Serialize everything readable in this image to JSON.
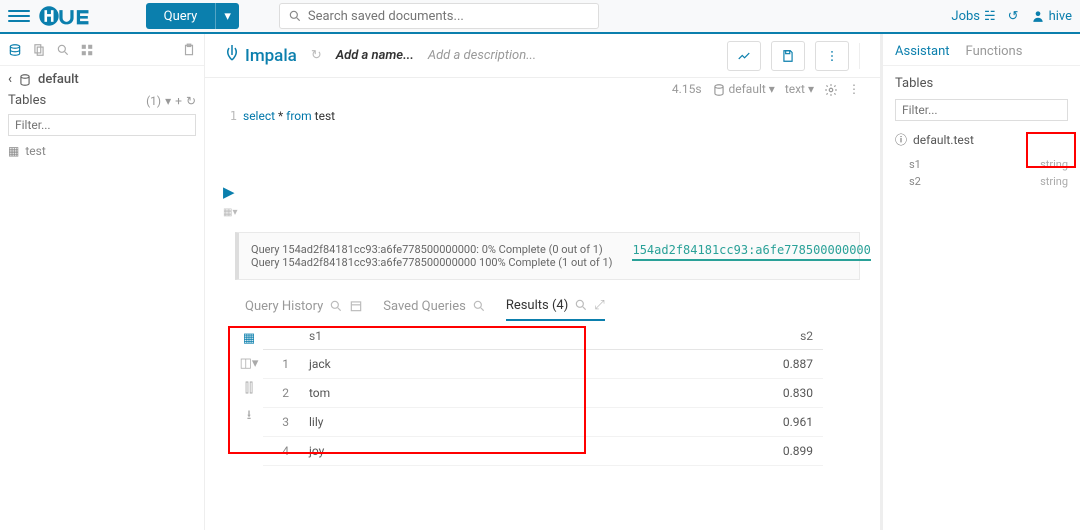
{
  "topbar": {
    "query_label": "Query",
    "search_placeholder": "Search saved documents...",
    "jobs_label": "Jobs",
    "user_label": "hive"
  },
  "left": {
    "breadcrumb_db": "default",
    "tables_label": "Tables",
    "tables_count": "(1)",
    "filter_placeholder": "Filter...",
    "items": [
      "test"
    ]
  },
  "editor": {
    "engine": "Impala",
    "add_name": "Add a name...",
    "add_desc": "Add a description...",
    "line_no": "1",
    "sql_kw1": "select",
    "sql_mid": " * ",
    "sql_kw2": "from",
    "sql_rest": " test",
    "meta_time": "4.15s",
    "meta_db": "default",
    "meta_fmt": "text"
  },
  "log": {
    "line1": "Query 154ad2f84181cc93:a6fe778500000000: 0% Complete (0 out of 1)",
    "line2": "Query 154ad2f84181cc93:a6fe778500000000 100% Complete (1 out of 1)",
    "link": "154ad2f84181cc93:a6fe778500000000"
  },
  "tabs": {
    "history": "Query History",
    "saved": "Saved Queries",
    "results": "Results (4)"
  },
  "results": {
    "headers": {
      "c1": "s1",
      "c2": "s2"
    },
    "rows": [
      {
        "i": "1",
        "s1": "jack",
        "s2": "0.887"
      },
      {
        "i": "2",
        "s1": "tom",
        "s2": "0.830"
      },
      {
        "i": "3",
        "s1": "lily",
        "s2": "0.961"
      },
      {
        "i": "4",
        "s1": "joy",
        "s2": "0.899"
      }
    ]
  },
  "right": {
    "tab1": "Assistant",
    "tab2": "Functions",
    "tables_label": "Tables",
    "filter_placeholder": "Filter...",
    "tbl_name": "default.test",
    "cols": [
      {
        "n": "s1",
        "t": "string"
      },
      {
        "n": "s2",
        "t": "string"
      }
    ]
  }
}
